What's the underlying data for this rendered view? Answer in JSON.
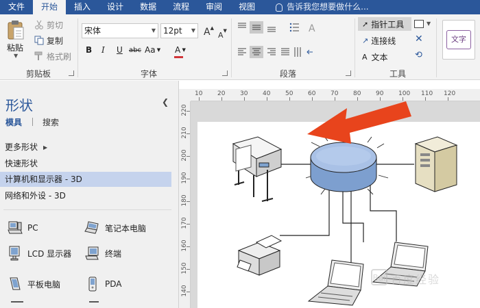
{
  "menu": {
    "tabs": [
      "文件",
      "开始",
      "插入",
      "设计",
      "数据",
      "流程",
      "审阅",
      "视图"
    ],
    "active_index": 1,
    "tell_me": "告诉我您想要做什么..."
  },
  "ribbon": {
    "clipboard": {
      "paste": "粘贴",
      "cut": "剪切",
      "copy": "复制",
      "format_painter": "格式刷",
      "group_label": "剪贴板"
    },
    "font": {
      "font_name": "宋体",
      "font_size": "12pt",
      "grow_label": "A",
      "shrink_label": "A",
      "bold": "B",
      "italic": "I",
      "underline": "U",
      "strike": "abc",
      "case": "Aa",
      "color_a": "A",
      "group_label": "字体",
      "font_color": "#d13438"
    },
    "paragraph": {
      "group_label": "段落"
    },
    "tools": {
      "pointer": "指针工具",
      "connector": "连接线",
      "text": "文本",
      "group_label": "工具"
    },
    "shape_styles": {
      "text_style_sample": "文字"
    }
  },
  "shapes_pane": {
    "title": "形状",
    "tabs": [
      "模具",
      "搜索"
    ],
    "stencils": [
      {
        "label": "更多形状",
        "has_arrow": true
      },
      {
        "label": "快速形状",
        "has_arrow": false
      },
      {
        "label": "计算机和显示器 - 3D",
        "has_arrow": false,
        "selected": true
      },
      {
        "label": "网络和外设 - 3D",
        "has_arrow": false
      }
    ],
    "items": [
      {
        "label": "PC",
        "icon": "pc-icon"
      },
      {
        "label": "笔记本电脑",
        "icon": "laptop-icon"
      },
      {
        "label": "LCD 显示器",
        "icon": "lcd-monitor-icon"
      },
      {
        "label": "终端",
        "icon": "terminal-icon"
      },
      {
        "label": "平板电脑",
        "icon": "tablet-icon"
      },
      {
        "label": "PDA",
        "icon": "pda-icon"
      }
    ]
  },
  "rulers": {
    "horizontal": [
      "10",
      "20",
      "30",
      "40",
      "50",
      "60",
      "70",
      "80",
      "90",
      "100",
      "110",
      "120"
    ],
    "vertical": [
      "220",
      "210",
      "200",
      "190",
      "180",
      "170",
      "160",
      "150",
      "140"
    ]
  },
  "diagram": {
    "nodes": [
      "plotter",
      "hub",
      "server",
      "printer",
      "laptop",
      "laptop"
    ],
    "annotation": "red-arrow",
    "hub_color": "#8fb0dc",
    "arrow_color": "#e8441c"
  },
  "watermark": {
    "text": "百度经验"
  },
  "colors": {
    "accent": "#2b579a",
    "selected_stencil": "#c5d3ed"
  }
}
